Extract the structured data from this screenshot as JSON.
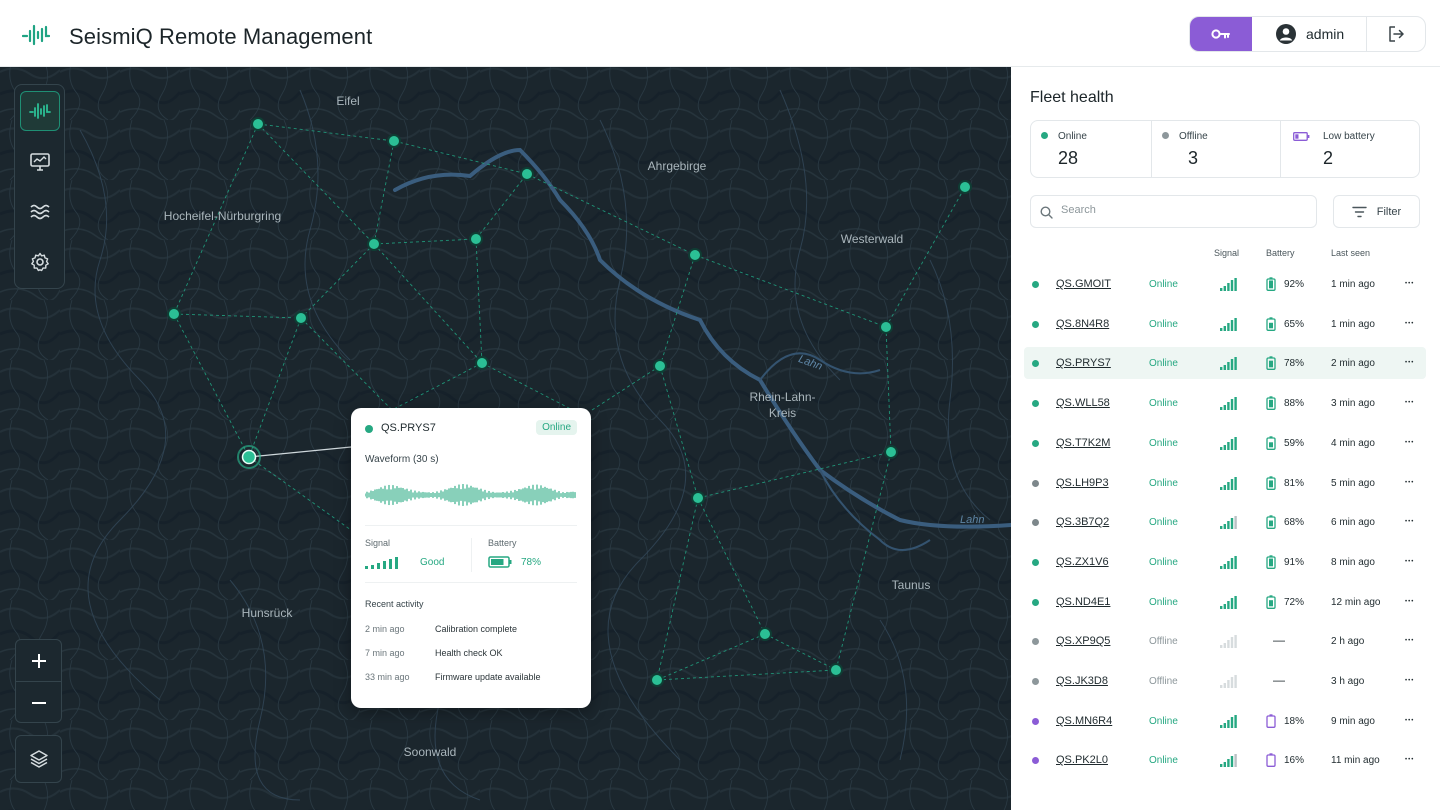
{
  "header": {
    "app_title": "SeismiQ Remote Management",
    "logo_icon": "seismic-wave-logo",
    "key_icon": "key-icon",
    "user_name": "admin",
    "accent": "#8b5cd6"
  },
  "map": {
    "regions": [
      {
        "id": "eifel",
        "label": "Eifel"
      },
      {
        "id": "ahrgebirge",
        "label": "Ahrgebirge"
      },
      {
        "id": "hocheifel",
        "label": "Hocheifel-Nürburgring"
      },
      {
        "id": "westerwald",
        "label": "Westerwald"
      },
      {
        "id": "rheinlahn",
        "label": "Rhein-Lahn-\nKreis"
      },
      {
        "id": "taunus",
        "label": "Taunus"
      },
      {
        "id": "hunsrueck",
        "label": "Hunsrück"
      },
      {
        "id": "soonwald",
        "label": "Soonwald"
      }
    ],
    "rivers": [
      {
        "id": "lahn1",
        "label": "Lahn"
      },
      {
        "id": "lahn2",
        "label": "Lahn"
      }
    ],
    "toolbar": [
      "waveform-icon",
      "monitor-icon",
      "waves-icon",
      "settings-icon"
    ],
    "zoom_in": "+",
    "zoom_out": "−"
  },
  "popup": {
    "station": "QS.PRYS7",
    "status": "Online",
    "waveform_label": "Waveform (30 s)",
    "signal_label": "Signal",
    "signal_value": "Good",
    "battery_label": "Battery",
    "battery_value": "78%",
    "battery_level": 0.78,
    "activity_title": "Recent activity",
    "activity": [
      {
        "time": "2 min ago",
        "text": "Calibration complete"
      },
      {
        "time": "7 min ago",
        "text": "Health check OK"
      },
      {
        "time": "33 min ago",
        "text": "Firmware update available"
      }
    ]
  },
  "panel": {
    "title": "Fleet health",
    "stats": [
      {
        "label": "Online",
        "value": "28",
        "color": "#26a882"
      },
      {
        "label": "Offline",
        "value": "3",
        "color": "#8d979b"
      },
      {
        "label": "Low battery",
        "value": "2",
        "color": "#8b5cd6"
      }
    ],
    "search_placeholder": "Search",
    "filter_label": "Filter",
    "columns": {
      "signal": "Signal",
      "battery": "Battery",
      "last_seen": "Last seen"
    },
    "rows": [
      {
        "name": "QS.GMOIT",
        "status": "Online",
        "online": true,
        "dot": "#26a882",
        "signal": 4,
        "battery": "92%",
        "level": 0.92,
        "seen": "1 min ago"
      },
      {
        "name": "QS.8N4R8",
        "status": "Online",
        "online": true,
        "dot": "#26a882",
        "signal": 4,
        "battery": "65%",
        "level": 0.65,
        "seen": "1 min ago"
      },
      {
        "name": "QS.PRYS7",
        "status": "Online",
        "online": true,
        "dot": "#26a882",
        "signal": 4,
        "battery": "78%",
        "level": 0.78,
        "seen": "2 min ago",
        "selected": true
      },
      {
        "name": "QS.WLL58",
        "status": "Online",
        "online": true,
        "dot": "#26a882",
        "signal": 4,
        "battery": "88%",
        "level": 0.88,
        "seen": "3 min ago"
      },
      {
        "name": "QS.T7K2M",
        "status": "Online",
        "online": true,
        "dot": "#26a882",
        "signal": 4,
        "battery": "59%",
        "level": 0.59,
        "seen": "4 min ago"
      },
      {
        "name": "QS.LH9P3",
        "status": "Online",
        "online": true,
        "dot": "#7d878b",
        "signal": 4,
        "battery": "81%",
        "level": 0.81,
        "seen": "5 min ago"
      },
      {
        "name": "QS.3B7Q2",
        "status": "Online",
        "online": true,
        "dot": "#7d878b",
        "signal": 3,
        "battery": "68%",
        "level": 0.68,
        "seen": "6 min ago"
      },
      {
        "name": "QS.ZX1V6",
        "status": "Online",
        "online": true,
        "dot": "#26a882",
        "signal": 4,
        "battery": "91%",
        "level": 0.91,
        "seen": "8 min ago"
      },
      {
        "name": "QS.ND4E1",
        "status": "Online",
        "online": true,
        "dot": "#26a882",
        "signal": 4,
        "battery": "72%",
        "level": 0.72,
        "seen": "12 min ago"
      },
      {
        "name": "QS.XP9Q5",
        "status": "Offline",
        "online": false,
        "dot": "#8d979b",
        "signal": 0,
        "battery": "—",
        "level": 0,
        "seen": "2 h ago"
      },
      {
        "name": "QS.JK3D8",
        "status": "Offline",
        "online": false,
        "dot": "#8d979b",
        "signal": 0,
        "battery": "—",
        "level": 0,
        "seen": "3 h ago"
      },
      {
        "name": "QS.MN6R4",
        "status": "Online",
        "online": true,
        "dot": "#8b5cd6",
        "signal": 4,
        "battery": "18%",
        "level": 0.18,
        "seen": "9 min ago",
        "low": true
      },
      {
        "name": "QS.PK2L0",
        "status": "Online",
        "online": true,
        "dot": "#8b5cd6",
        "signal": 3,
        "battery": "16%",
        "level": 0.16,
        "seen": "11 min ago",
        "low": true
      }
    ]
  }
}
